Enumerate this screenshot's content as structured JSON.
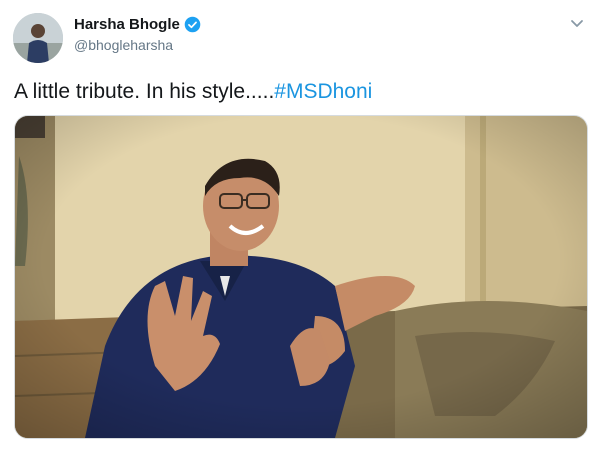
{
  "tweet": {
    "author": {
      "display_name": "Harsha Bhogle",
      "handle": "@bhogleharsha",
      "verified": true,
      "avatar_icon": "profile-photo"
    },
    "text": "A little tribute. In his style.....",
    "hashtag": "#MSDhoni",
    "menu_icon": "chevron-down-icon",
    "media": {
      "type": "video-still",
      "description_icon": "video-frame"
    }
  },
  "colors": {
    "link": "#1b95e0",
    "verified": "#1da1f2",
    "secondary_text": "#657786",
    "primary_text": "#14171a"
  }
}
